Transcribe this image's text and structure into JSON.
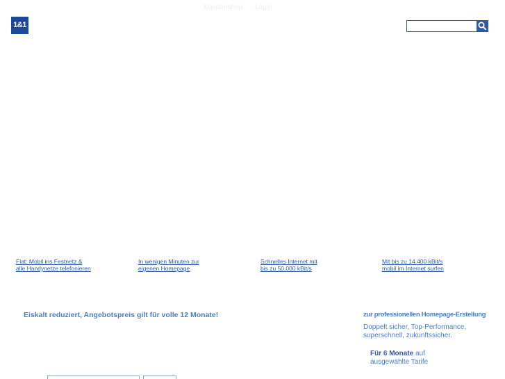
{
  "header": {
    "links": {
      "shop": "Kundenshop",
      "login": "Login"
    },
    "logo_text": "1&1",
    "search": {
      "placeholder": "",
      "value": "",
      "button_icon": "search-icon"
    }
  },
  "features": [
    {
      "line1": "Flat: Mobil ins Festnetz &",
      "line2": "alle Handynetze telefonieren"
    },
    {
      "line1": "In wenigen Minuten zur",
      "line2": "eigenen Homepage"
    },
    {
      "line1": "Schnelles Internet mit",
      "line2": "bis zu 50.000 kBit/s"
    },
    {
      "line1": "Mit bis zu 14.400 kBit/s",
      "line2": "mobil im Internet surfen"
    }
  ],
  "promo": {
    "headline": "Eiskalt reduziert, Angebotspreis gilt für volle 12 Monate!"
  },
  "side": {
    "heading": "zur professionellen Homepage-Erstellung",
    "desc_line1": "Doppelt sicher, Top-Performance,",
    "desc_line2": "superschnell, zukunftssicher.",
    "offer_bold": "Für 6 Monate",
    "offer_rest": " auf",
    "offer_line2": "ausgewählte Tarife"
  },
  "colors": {
    "brand_blue": "#1e4a9a",
    "text_blue": "#2f5dab",
    "light_blue": "#4b7fc8"
  }
}
